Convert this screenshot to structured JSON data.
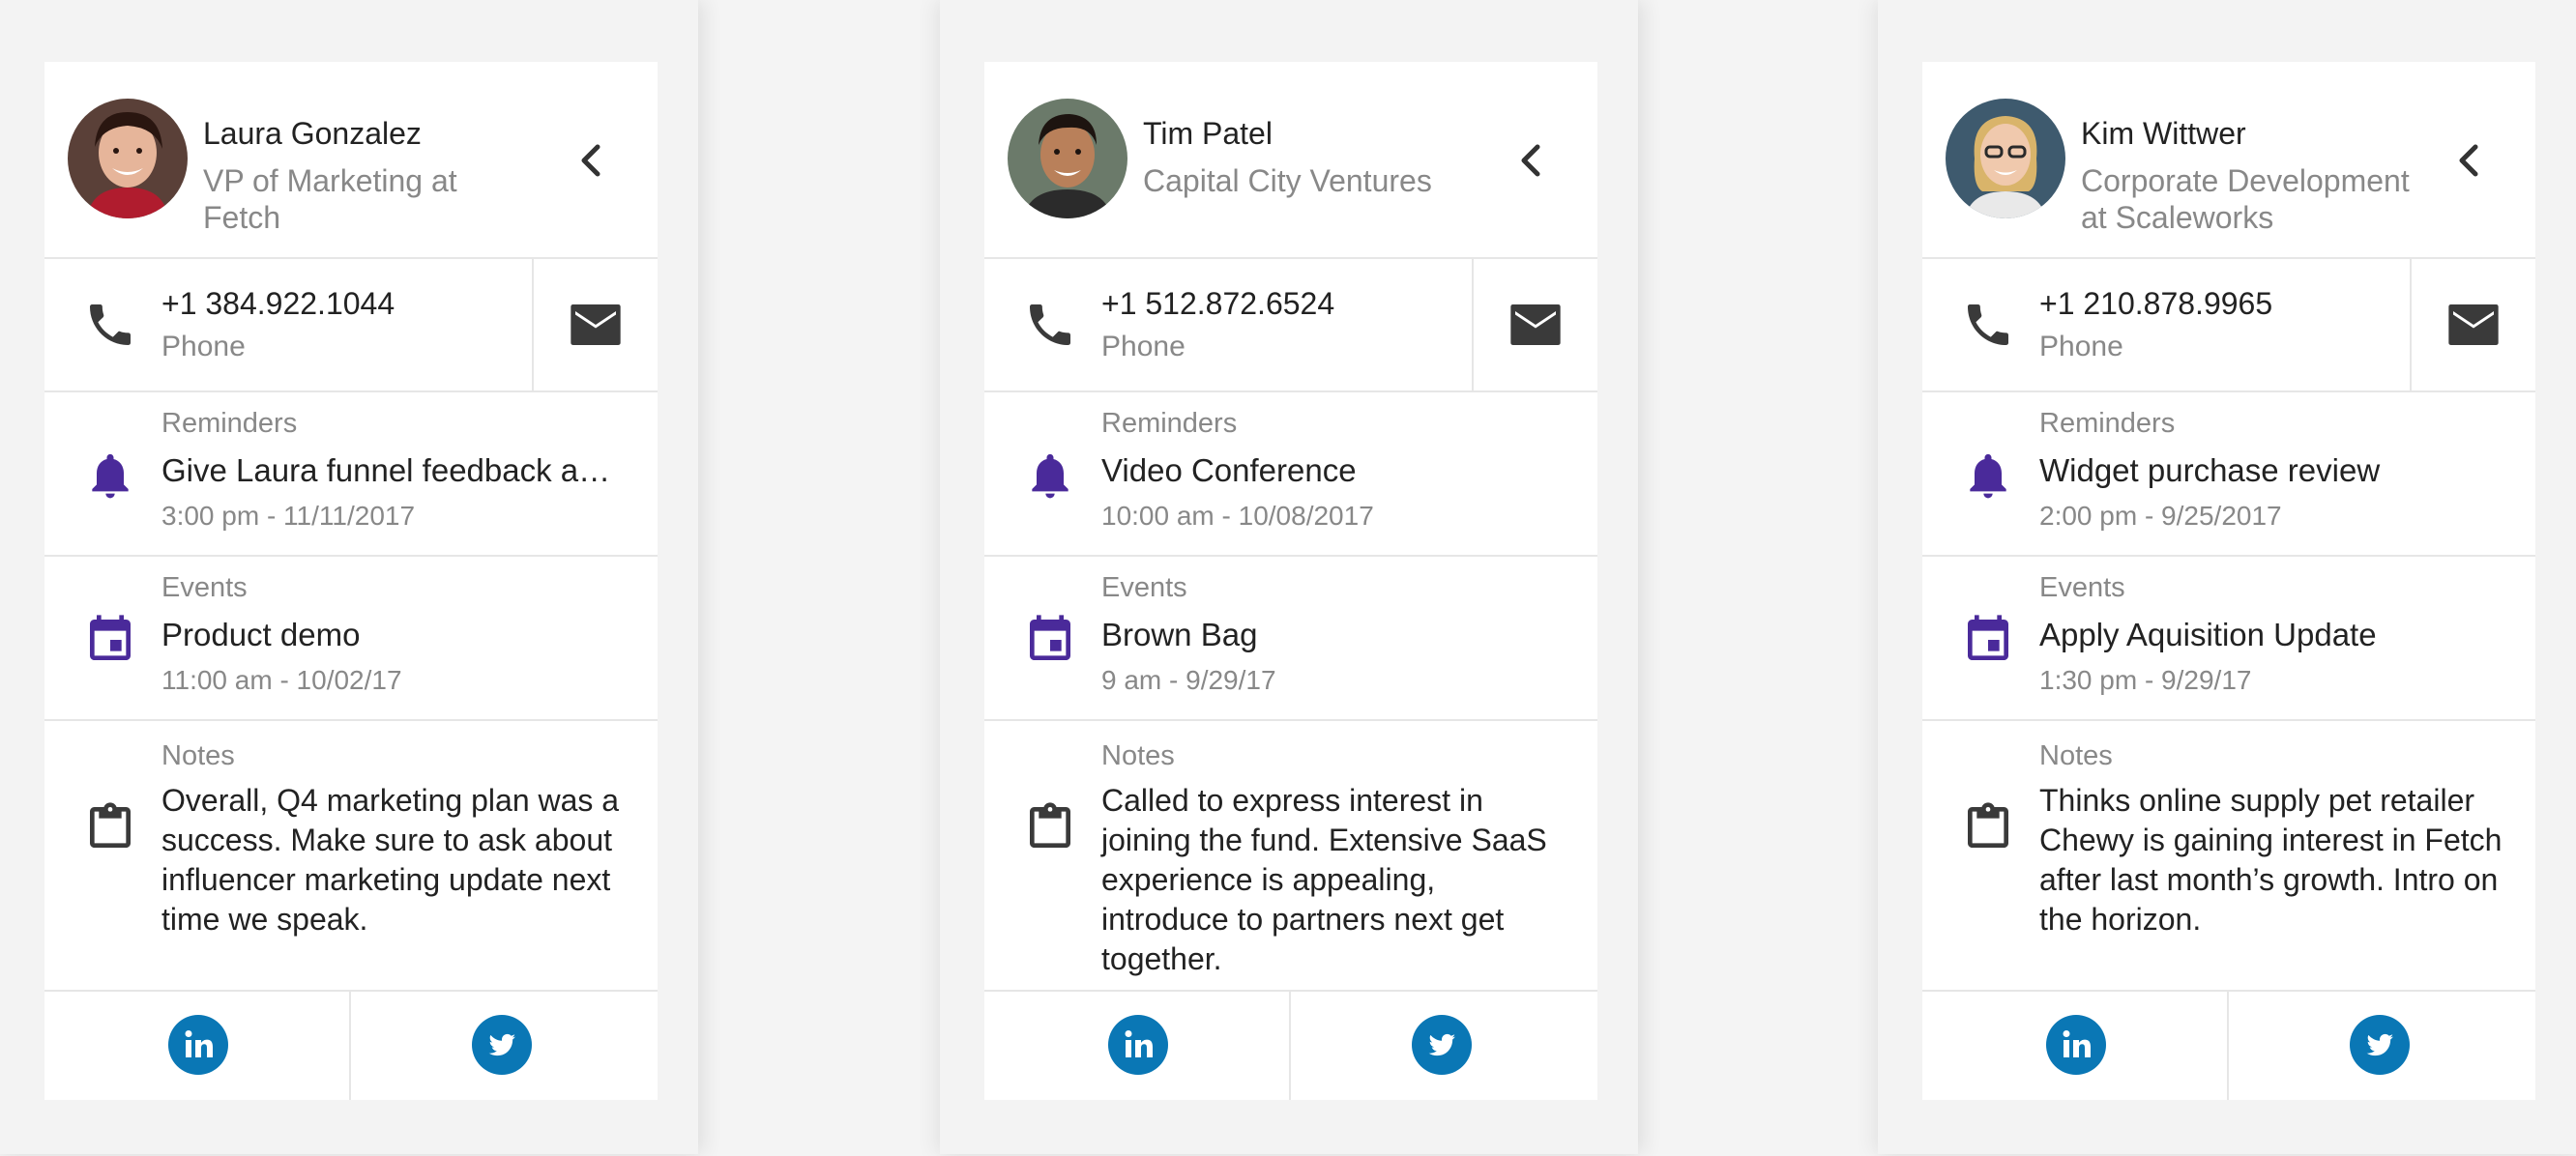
{
  "colors": {
    "accent_purple": "#4a2a9a",
    "social_blue": "#0a77b5",
    "icon_dark": "#3a3a3a"
  },
  "icons": {
    "collapse": "chevron-left-icon",
    "phone": "phone-icon",
    "mail": "mail-icon",
    "reminder": "bell-icon",
    "event": "calendar-icon",
    "notes": "clipboard-icon",
    "linkedin": "linkedin-icon",
    "twitter": "twitter-icon"
  },
  "cards": [
    {
      "name": "Laura Gonzalez",
      "subtitle": "VP of Marketing at Fetch",
      "phone": "+1 384.922.1044",
      "phone_label": "Phone",
      "reminders_label": "Reminders",
      "reminder_title": "Give Laura funnel feedback  about the launch plan",
      "reminder_time": "3:00 pm - 11/11/2017",
      "events_label": "Events",
      "event_title": "Product demo",
      "event_time": "11:00 am - 10/02/17",
      "notes_label": "Notes",
      "notes_text": "Overall, Q4 marketing plan was a success. Make sure to ask about influencer marketing update next time we speak."
    },
    {
      "name": "Tim Patel",
      "subtitle": "Capital City Ventures",
      "phone": "+1 512.872.6524",
      "phone_label": "Phone",
      "reminders_label": "Reminders",
      "reminder_title": "Video Conference",
      "reminder_time": "10:00 am - 10/08/2017",
      "events_label": "Events",
      "event_title": "Brown Bag",
      "event_time": "9 am - 9/29/17",
      "notes_label": "Notes",
      "notes_text": "Called to express interest in joining the fund. Extensive SaaS experience is appealing, introduce to partners next get together."
    },
    {
      "name": "Kim Wittwer",
      "subtitle": "Corporate Development at Scaleworks",
      "phone": "+1 210.878.9965",
      "phone_label": "Phone",
      "reminders_label": "Reminders",
      "reminder_title": "Widget purchase review",
      "reminder_time": "2:00 pm - 9/25/2017",
      "events_label": "Events",
      "event_title": "Apply Aquisition Update",
      "event_time": "1:30 pm - 9/29/17",
      "notes_label": "Notes",
      "notes_text": "Thinks online supply pet retailer Chewy is gaining interest in Fetch after last month’s growth. Intro on the horizon."
    }
  ]
}
